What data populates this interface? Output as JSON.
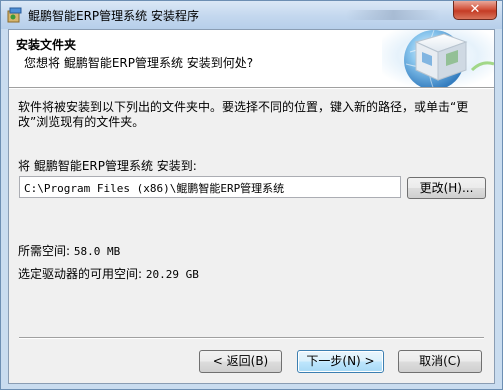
{
  "window": {
    "title": "鲲鹏智能ERP管理系统 安装程序",
    "close_label": "✕",
    "icon_name": "installer-app-icon"
  },
  "header": {
    "title": "安装文件夹",
    "subtitle": "您想将 鲲鹏智能ERP管理系统 安装到何处?",
    "graphic_name": "globe-box-graphic"
  },
  "body": {
    "description": "软件将被安装到以下列出的文件夹中。要选择不同的位置，键入新的路径，或单击“更改”浏览现有的文件夹。",
    "install_label": "将 鲲鹏智能ERP管理系统 安装到:",
    "install_path": "C:\\Program Files (x86)\\鲲鹏智能ERP管理系统",
    "browse_label": "更改(H)...",
    "space_required_label": "所需空间:",
    "space_required_value": "58.0 MB",
    "space_available_label": "选定驱动器的可用空间:",
    "space_available_value": "20.29 GB"
  },
  "buttons": {
    "back": "< 返回(B)",
    "next": "下一步(N) >",
    "cancel": "取消(C)"
  },
  "colors": {
    "frame": "#c9dcef",
    "client": "#f0f0f0",
    "close_red": "#c43c25",
    "default_button_border": "#3c7fb1"
  }
}
